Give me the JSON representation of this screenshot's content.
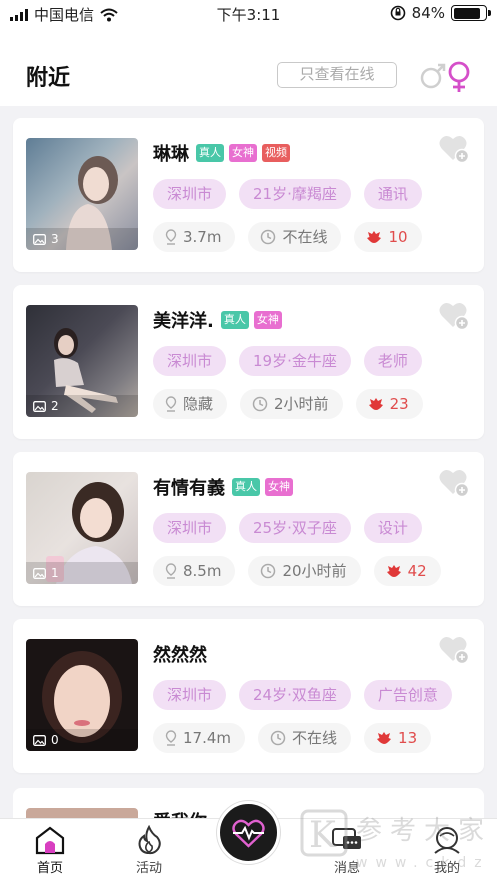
{
  "status": {
    "carrier": "中国电信",
    "time": "下午3:11",
    "battery": "84%"
  },
  "header": {
    "title": "附近",
    "online_filter": "只查看在线"
  },
  "users": [
    {
      "name": "琳琳",
      "badges": [
        {
          "text": "真人",
          "color": "#49c7a8"
        },
        {
          "text": "女神",
          "color": "#e86fd0"
        },
        {
          "text": "视频",
          "color": "#e85e5e"
        }
      ],
      "photos": "3",
      "tags": [
        "深圳市",
        "21岁·摩羯座",
        "通讯"
      ],
      "distance": "3.7m",
      "status": "不在线",
      "flowers": "10"
    },
    {
      "name": "美洋洋.",
      "badges": [
        {
          "text": "真人",
          "color": "#49c7a8"
        },
        {
          "text": "女神",
          "color": "#e86fd0"
        }
      ],
      "photos": "2",
      "tags": [
        "深圳市",
        "19岁·金牛座",
        "老师"
      ],
      "distance": "隐藏",
      "status": "2小时前",
      "flowers": "23"
    },
    {
      "name": "有情有義",
      "badges": [
        {
          "text": "真人",
          "color": "#49c7a8"
        },
        {
          "text": "女神",
          "color": "#e86fd0"
        }
      ],
      "photos": "1",
      "tags": [
        "深圳市",
        "25岁·双子座",
        "设计"
      ],
      "distance": "8.5m",
      "status": "20小时前",
      "flowers": "42"
    },
    {
      "name": "然然然",
      "badges": [],
      "photos": "0",
      "tags": [
        "深圳市",
        "24岁·双鱼座",
        "广告创意"
      ],
      "distance": "17.4m",
      "status": "不在线",
      "flowers": "13"
    }
  ],
  "peek": {
    "name": "爱我你"
  },
  "tabs": {
    "home": "首页",
    "activity": "活动",
    "messages": "消息",
    "mine": "我的"
  },
  "watermark": "参考大家 www.ckdz"
}
